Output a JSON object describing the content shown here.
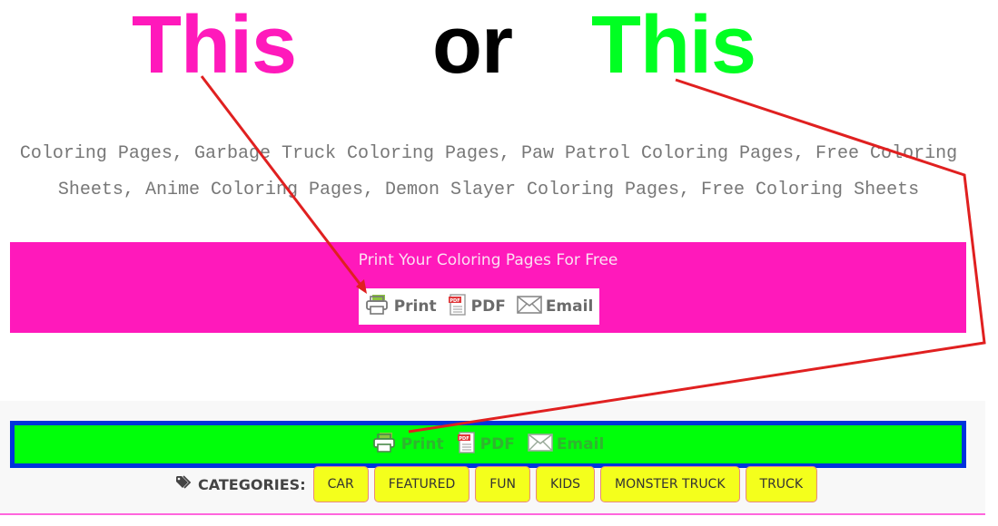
{
  "headline": {
    "word1": "This",
    "word2": "or",
    "word3": "This",
    "colors": {
      "word1": "#ff19bb",
      "word2": "#000000",
      "word3": "#00ff22"
    }
  },
  "tags_text": "Coloring Pages, Garbage Truck Coloring Pages, Paw Patrol Coloring Pages, Free Coloring Sheets, Anime Coloring Pages, Demon Slayer Coloring Pages, Free Coloring Sheets",
  "pink_section": {
    "title": "Print Your Coloring Pages For Free",
    "background": "#ff19bb",
    "buttons": {
      "print": "Print",
      "pdf": "PDF",
      "email": "Email"
    }
  },
  "green_section": {
    "background": "#00ff0a",
    "border": "#0033dd",
    "buttons": {
      "print": "Print",
      "pdf": "PDF",
      "email": "Email"
    }
  },
  "categories": {
    "label": "CATEGORIES:",
    "items": [
      "CAR",
      "FEATURED",
      "FUN",
      "KIDS",
      "MONSTER TRUCK",
      "TRUCK"
    ]
  },
  "annotation_color": "#e02020"
}
